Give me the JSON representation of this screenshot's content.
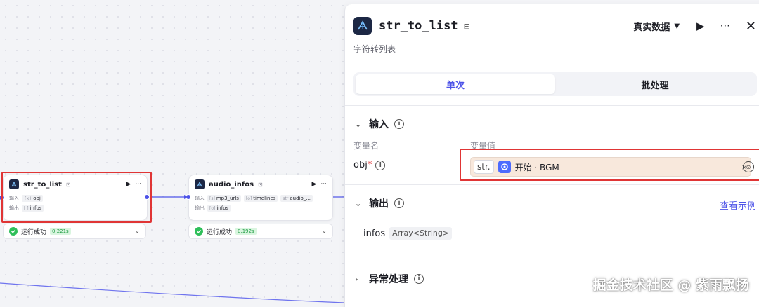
{
  "canvas": {
    "node1": {
      "title": "str_to_list",
      "input_label": "输入",
      "output_label": "输出",
      "input_tag": "obj",
      "output_tag": "infos",
      "status_text": "运行成功",
      "status_time": "0.221s"
    },
    "node2": {
      "title": "audio_infos",
      "input_label": "输入",
      "output_label": "输出",
      "input_tags": [
        "mp3_urls",
        "timelines",
        "audio_..."
      ],
      "output_tag": "infos",
      "status_text": "运行成功",
      "status_time": "0.192s"
    }
  },
  "panel": {
    "title": "str_to_list",
    "description": "字符转列表",
    "data_mode": "真实数据",
    "tabs": [
      {
        "label": "单次",
        "active": true
      },
      {
        "label": "批处理",
        "active": false
      }
    ],
    "input_section": {
      "title": "输入",
      "col_name": "变量名",
      "col_value": "变量值",
      "var_name": "obj",
      "required_mark": "*",
      "value_type_tag": "str.",
      "value_ref": "开始 · BGM",
      "clear_symbol": "×"
    },
    "output_section": {
      "title": "输出",
      "view_example": "查看示例",
      "out_name": "infos",
      "out_type": "Array<String>"
    },
    "error_section": {
      "title": "异常处理"
    }
  },
  "watermark": "掘金技术社区 @ 紫雨飘扬",
  "colors": {
    "accent": "#4d53e8",
    "success": "#2fbf5a",
    "highlight": "#e03535",
    "input_bg": "#f8e8dc"
  }
}
